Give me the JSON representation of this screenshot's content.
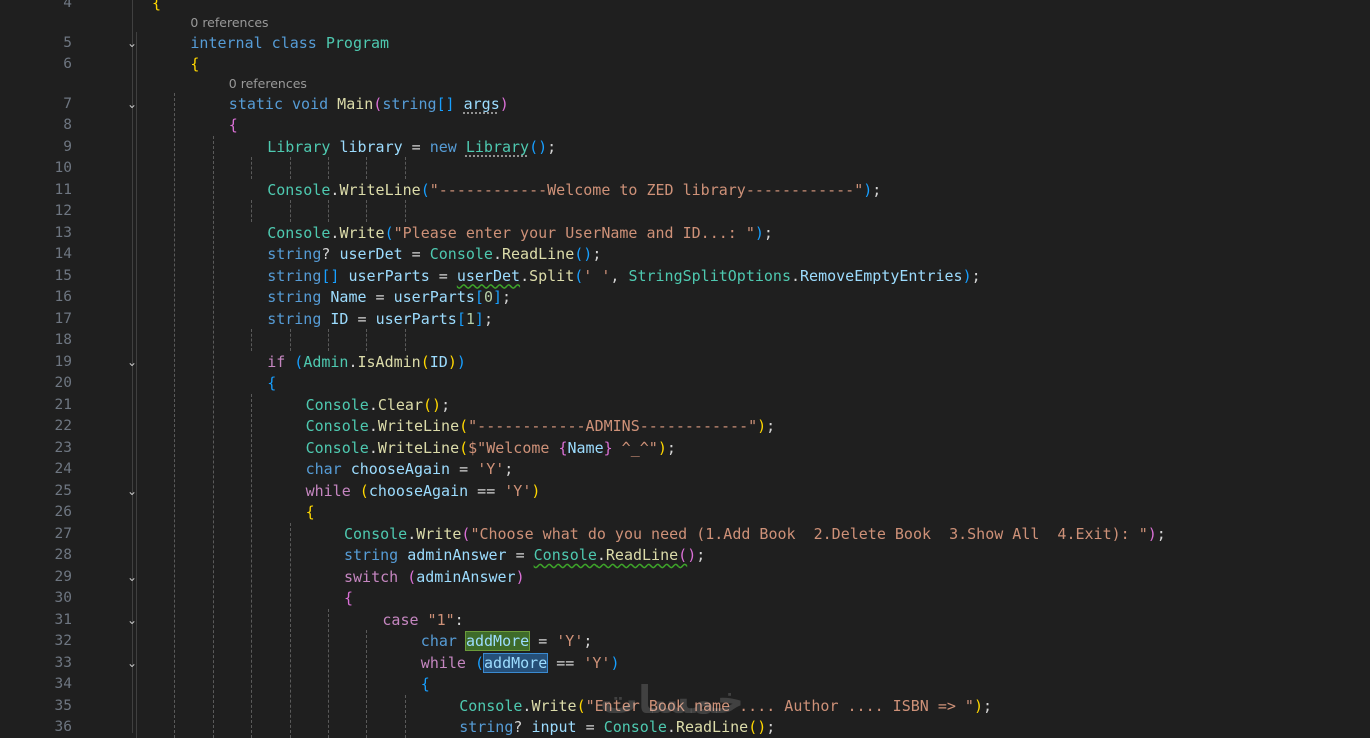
{
  "editor": {
    "language": "C#",
    "codelens": [
      {
        "line": 5,
        "text": "0 references"
      },
      {
        "line": 7,
        "text": "0 references"
      }
    ],
    "lines": [
      {
        "n": "4",
        "indent": 0,
        "fold": false,
        "tokens": [
          [
            "{",
            "b1"
          ]
        ]
      },
      {
        "n": "5",
        "indent": 1,
        "fold": true,
        "tokens": [
          [
            "internal",
            "kw"
          ],
          [
            " ",
            "p"
          ],
          [
            "class",
            "kw"
          ],
          [
            " ",
            "p"
          ],
          [
            "Program",
            "ty"
          ]
        ]
      },
      {
        "n": "6",
        "indent": 1,
        "fold": false,
        "tokens": [
          [
            "{",
            "b1"
          ]
        ]
      },
      {
        "n": "7",
        "indent": 2,
        "fold": true,
        "tokens": [
          [
            "static",
            "kw"
          ],
          [
            " ",
            "p"
          ],
          [
            "void",
            "kw"
          ],
          [
            " ",
            "p"
          ],
          [
            "Main",
            "fn"
          ],
          [
            "(",
            "b2"
          ],
          [
            "string",
            "kw"
          ],
          [
            "[]",
            "b3"
          ],
          [
            " ",
            "p"
          ],
          [
            "args",
            "var dots"
          ],
          [
            ")",
            "b2"
          ]
        ]
      },
      {
        "n": "8",
        "indent": 2,
        "fold": false,
        "tokens": [
          [
            "{",
            "b2"
          ]
        ]
      },
      {
        "n": "9",
        "indent": 3,
        "fold": false,
        "tokens": [
          [
            "Library",
            "ty"
          ],
          [
            " ",
            "p"
          ],
          [
            "library",
            "var"
          ],
          [
            " = ",
            "p"
          ],
          [
            "new",
            "kw"
          ],
          [
            " ",
            "p"
          ],
          [
            "Library",
            "ty dots"
          ],
          [
            "(",
            "b3"
          ],
          [
            ")",
            "b3"
          ],
          [
            ";",
            "p"
          ]
        ]
      },
      {
        "n": "10",
        "indent": 0,
        "fold": false,
        "tokens": []
      },
      {
        "n": "11",
        "indent": 3,
        "fold": false,
        "tokens": [
          [
            "Console",
            "ty"
          ],
          [
            ".",
            "p"
          ],
          [
            "WriteLine",
            "fn"
          ],
          [
            "(",
            "b3"
          ],
          [
            "\"------------Welcome to ZED library------------\"",
            "str"
          ],
          [
            ")",
            "b3"
          ],
          [
            ";",
            "p"
          ]
        ]
      },
      {
        "n": "12",
        "indent": 0,
        "fold": false,
        "tokens": []
      },
      {
        "n": "13",
        "indent": 3,
        "fold": false,
        "tokens": [
          [
            "Console",
            "ty"
          ],
          [
            ".",
            "p"
          ],
          [
            "Write",
            "fn"
          ],
          [
            "(",
            "b3"
          ],
          [
            "\"Please enter your UserName and ID...: \"",
            "str"
          ],
          [
            ")",
            "b3"
          ],
          [
            ";",
            "p"
          ]
        ]
      },
      {
        "n": "14",
        "indent": 3,
        "fold": false,
        "tokens": [
          [
            "string",
            "kw"
          ],
          [
            "? ",
            "p"
          ],
          [
            "userDet",
            "var"
          ],
          [
            " = ",
            "p"
          ],
          [
            "Console",
            "ty"
          ],
          [
            ".",
            "p"
          ],
          [
            "ReadLine",
            "fn"
          ],
          [
            "(",
            "b3"
          ],
          [
            ")",
            "b3"
          ],
          [
            ";",
            "p"
          ]
        ]
      },
      {
        "n": "15",
        "indent": 3,
        "fold": false,
        "tokens": [
          [
            "string",
            "kw"
          ],
          [
            "[]",
            "b3"
          ],
          [
            " ",
            "p"
          ],
          [
            "userParts",
            "var"
          ],
          [
            " = ",
            "p"
          ],
          [
            "userDet",
            "var squig"
          ],
          [
            ".",
            "p"
          ],
          [
            "Split",
            "fn"
          ],
          [
            "(",
            "b3"
          ],
          [
            "' '",
            "str"
          ],
          [
            ", ",
            "p"
          ],
          [
            "StringSplitOptions",
            "ty"
          ],
          [
            ".",
            "p"
          ],
          [
            "RemoveEmptyEntries",
            "var"
          ],
          [
            ")",
            "b3"
          ],
          [
            ";",
            "p"
          ]
        ]
      },
      {
        "n": "16",
        "indent": 3,
        "fold": false,
        "tokens": [
          [
            "string",
            "kw"
          ],
          [
            " ",
            "p"
          ],
          [
            "Name",
            "var"
          ],
          [
            " = ",
            "p"
          ],
          [
            "userParts",
            "var"
          ],
          [
            "[",
            "b3"
          ],
          [
            "0",
            "num"
          ],
          [
            "]",
            "b3"
          ],
          [
            ";",
            "p"
          ]
        ]
      },
      {
        "n": "17",
        "indent": 3,
        "fold": false,
        "tokens": [
          [
            "string",
            "kw"
          ],
          [
            " ",
            "p"
          ],
          [
            "ID",
            "var"
          ],
          [
            " = ",
            "p"
          ],
          [
            "userParts",
            "var"
          ],
          [
            "[",
            "b3"
          ],
          [
            "1",
            "num"
          ],
          [
            "]",
            "b3"
          ],
          [
            ";",
            "p"
          ]
        ]
      },
      {
        "n": "18",
        "indent": 0,
        "fold": false,
        "tokens": []
      },
      {
        "n": "19",
        "indent": 3,
        "fold": true,
        "tokens": [
          [
            "if",
            "ctl"
          ],
          [
            " ",
            "p"
          ],
          [
            "(",
            "b3"
          ],
          [
            "Admin",
            "ty"
          ],
          [
            ".",
            "p"
          ],
          [
            "IsAdmin",
            "fn"
          ],
          [
            "(",
            "b1"
          ],
          [
            "ID",
            "var"
          ],
          [
            ")",
            "b1"
          ],
          [
            ")",
            "b3"
          ]
        ]
      },
      {
        "n": "20",
        "indent": 3,
        "fold": false,
        "tokens": [
          [
            "{",
            "b3"
          ]
        ]
      },
      {
        "n": "21",
        "indent": 4,
        "fold": false,
        "tokens": [
          [
            "Console",
            "ty"
          ],
          [
            ".",
            "p"
          ],
          [
            "Clear",
            "fn"
          ],
          [
            "(",
            "b1"
          ],
          [
            ")",
            "b1"
          ],
          [
            ";",
            "p"
          ]
        ]
      },
      {
        "n": "22",
        "indent": 4,
        "fold": false,
        "tokens": [
          [
            "Console",
            "ty"
          ],
          [
            ".",
            "p"
          ],
          [
            "WriteLine",
            "fn"
          ],
          [
            "(",
            "b1"
          ],
          [
            "\"------------ADMINS------------\"",
            "str"
          ],
          [
            ")",
            "b1"
          ],
          [
            ";",
            "p"
          ]
        ]
      },
      {
        "n": "23",
        "indent": 4,
        "fold": false,
        "tokens": [
          [
            "Console",
            "ty"
          ],
          [
            ".",
            "p"
          ],
          [
            "WriteLine",
            "fn"
          ],
          [
            "(",
            "b1"
          ],
          [
            "$\"Welcome ",
            "str"
          ],
          [
            "{",
            "b2"
          ],
          [
            "Name",
            "var"
          ],
          [
            "}",
            "b2"
          ],
          [
            " ^_^\"",
            "str"
          ],
          [
            ")",
            "b1"
          ],
          [
            ";",
            "p"
          ]
        ]
      },
      {
        "n": "24",
        "indent": 4,
        "fold": false,
        "tokens": [
          [
            "char",
            "kw"
          ],
          [
            " ",
            "p"
          ],
          [
            "chooseAgain",
            "var"
          ],
          [
            " = ",
            "p"
          ],
          [
            "'Y'",
            "str"
          ],
          [
            ";",
            "p"
          ]
        ]
      },
      {
        "n": "25",
        "indent": 4,
        "fold": true,
        "tokens": [
          [
            "while",
            "ctl"
          ],
          [
            " ",
            "p"
          ],
          [
            "(",
            "b1"
          ],
          [
            "chooseAgain",
            "var"
          ],
          [
            " == ",
            "p"
          ],
          [
            "'Y'",
            "str"
          ],
          [
            ")",
            "b1"
          ]
        ]
      },
      {
        "n": "26",
        "indent": 4,
        "fold": false,
        "tokens": [
          [
            "{",
            "b1"
          ]
        ]
      },
      {
        "n": "27",
        "indent": 5,
        "fold": false,
        "tokens": [
          [
            "Console",
            "ty"
          ],
          [
            ".",
            "p"
          ],
          [
            "Write",
            "fn"
          ],
          [
            "(",
            "b2"
          ],
          [
            "\"Choose what do you need (1.Add Book  2.Delete Book  3.Show All  4.Exit): \"",
            "str"
          ],
          [
            ")",
            "b2"
          ],
          [
            ";",
            "p"
          ]
        ]
      },
      {
        "n": "28",
        "indent": 5,
        "fold": false,
        "tokens": [
          [
            "string",
            "kw"
          ],
          [
            " ",
            "p"
          ],
          [
            "adminAnswer",
            "var"
          ],
          [
            " = ",
            "p"
          ],
          [
            "Console",
            "ty squig"
          ],
          [
            ".",
            "p squig"
          ],
          [
            "ReadLine",
            "fn squig"
          ],
          [
            "(",
            "b2 squig"
          ],
          [
            ")",
            "b2"
          ],
          [
            ";",
            "p"
          ]
        ]
      },
      {
        "n": "29",
        "indent": 5,
        "fold": true,
        "tokens": [
          [
            "switch",
            "ctl"
          ],
          [
            " ",
            "p"
          ],
          [
            "(",
            "b2"
          ],
          [
            "adminAnswer",
            "var"
          ],
          [
            ")",
            "b2"
          ]
        ]
      },
      {
        "n": "30",
        "indent": 5,
        "fold": false,
        "tokens": [
          [
            "{",
            "b2"
          ]
        ]
      },
      {
        "n": "31",
        "indent": 6,
        "fold": true,
        "tokens": [
          [
            "case",
            "ctl"
          ],
          [
            " ",
            "p"
          ],
          [
            "\"1\"",
            "str"
          ],
          [
            ":",
            "p"
          ]
        ]
      },
      {
        "n": "32",
        "indent": 7,
        "fold": false,
        "tokens": [
          [
            "char",
            "kw"
          ],
          [
            " ",
            "p"
          ],
          [
            "addMore",
            "var hlw"
          ],
          [
            " = ",
            "p"
          ],
          [
            "'Y'",
            "str"
          ],
          [
            ";",
            "p"
          ]
        ]
      },
      {
        "n": "33",
        "indent": 7,
        "fold": true,
        "tokens": [
          [
            "while",
            "ctl"
          ],
          [
            " ",
            "p"
          ],
          [
            "(",
            "b3"
          ],
          [
            "addMore",
            "var hlr"
          ],
          [
            " == ",
            "p"
          ],
          [
            "'Y'",
            "str"
          ],
          [
            ")",
            "b3"
          ]
        ]
      },
      {
        "n": "34",
        "indent": 7,
        "fold": false,
        "tokens": [
          [
            "{",
            "b3"
          ]
        ]
      },
      {
        "n": "35",
        "indent": 8,
        "fold": false,
        "tokens": [
          [
            "Console",
            "ty"
          ],
          [
            ".",
            "p"
          ],
          [
            "Write",
            "fn"
          ],
          [
            "(",
            "b1"
          ],
          [
            "\"Enter Book name .... Author .... ISBN => \"",
            "str"
          ],
          [
            ")",
            "b1"
          ],
          [
            ";",
            "p"
          ]
        ]
      },
      {
        "n": "36",
        "indent": 8,
        "fold": false,
        "tokens": [
          [
            "string",
            "kw"
          ],
          [
            "? ",
            "p"
          ],
          [
            "input",
            "var"
          ],
          [
            " = ",
            "p"
          ],
          [
            "Console",
            "ty"
          ],
          [
            ".",
            "p"
          ],
          [
            "ReadLine",
            "fn"
          ],
          [
            "(",
            "b1"
          ],
          [
            ")",
            "b1"
          ],
          [
            ";",
            "p"
          ]
        ]
      }
    ]
  },
  "watermark": "خمسات"
}
